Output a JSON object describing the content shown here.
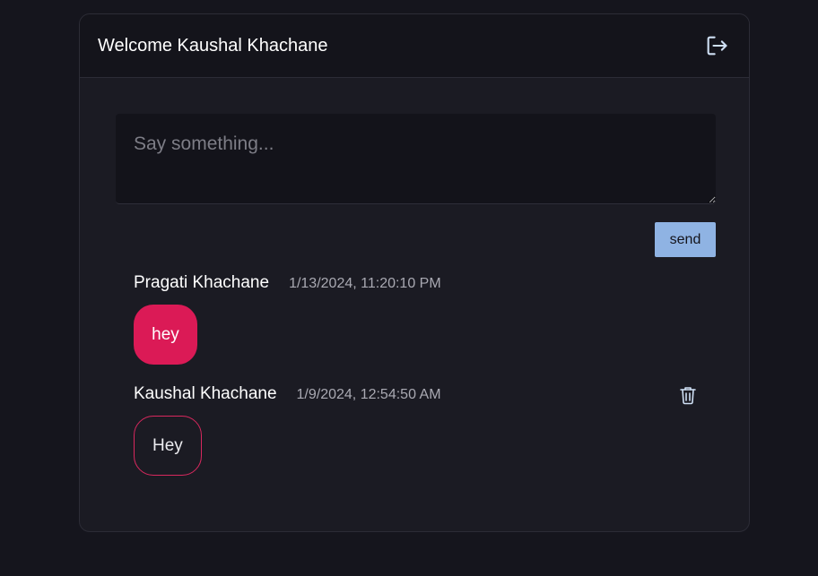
{
  "header": {
    "welcome_text": "Welcome Kaushal Khachane",
    "logout_icon": "logout-icon"
  },
  "composer": {
    "placeholder": "Say something...",
    "value": "",
    "send_label": "send"
  },
  "messages": [
    {
      "author": "Pragati Khachane",
      "timestamp": "1/13/2024, 11:20:10 PM",
      "text": "hey",
      "style": "filled",
      "deletable": false
    },
    {
      "author": "Kaushal Khachane",
      "timestamp": "1/9/2024, 12:54:50 AM",
      "text": "Hey",
      "style": "outlined",
      "deletable": true
    }
  ],
  "colors": {
    "background": "#15151d",
    "card": "#1b1b23",
    "accent_bubble": "#db1a56",
    "send_button": "#8fb3e3",
    "icon": "#cfe0f5"
  }
}
